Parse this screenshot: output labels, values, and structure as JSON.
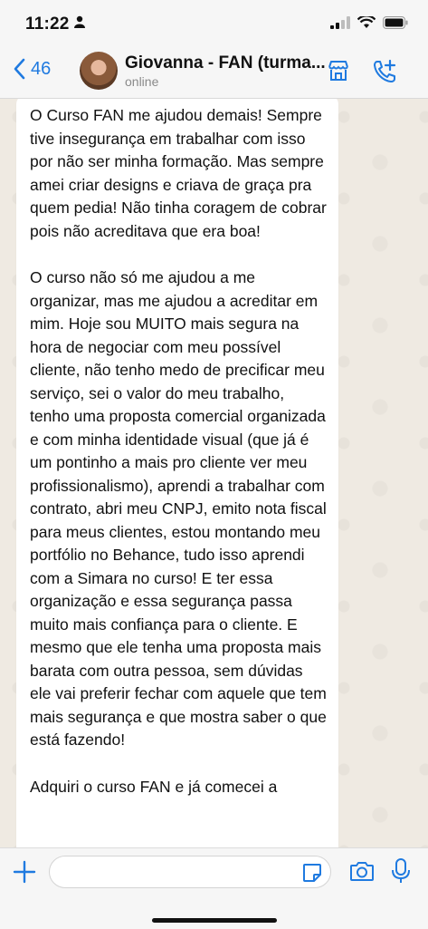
{
  "status_bar": {
    "time": "11:22"
  },
  "header": {
    "back_count": "46",
    "contact_name": "Giovanna - FAN (turma...",
    "contact_status": "online"
  },
  "message": {
    "paragraphs": [
      "O Curso FAN me ajudou demais! Sempre tive insegurança em trabalhar com isso por não ser minha formação. Mas sempre amei criar designs e criava de graça pra quem pedia! Não tinha coragem de cobrar pois não acreditava que era boa!",
      "O curso não só me ajudou a me organizar, mas me ajudou a acreditar em mim. Hoje sou MUITO mais segura na hora de negociar com meu possível cliente, não tenho medo de precificar meu serviço, sei o valor do meu trabalho, tenho uma proposta comercial organizada e com minha identidade visual (que já é um pontinho a mais pro cliente ver meu profissionalismo), aprendi a trabalhar com contrato, abri meu CNPJ, emito nota fiscal para meus clientes, estou montando meu portfólio no Behance, tudo isso aprendi com a Simara no curso!  E ter essa organização e essa segurança passa muito mais confiança para o cliente. E mesmo que ele tenha uma proposta mais barata com outra pessoa, sem dúvidas ele vai preferir fechar com aquele que tem mais segurança e que mostra saber o que está fazendo!",
      "Adquiri o curso FAN e já comecei a"
    ]
  },
  "input": {
    "value": "",
    "placeholder": ""
  },
  "colors": {
    "accent": "#1f7ae0",
    "bubble": "#ffffff",
    "chat_bg": "#efeae2"
  }
}
